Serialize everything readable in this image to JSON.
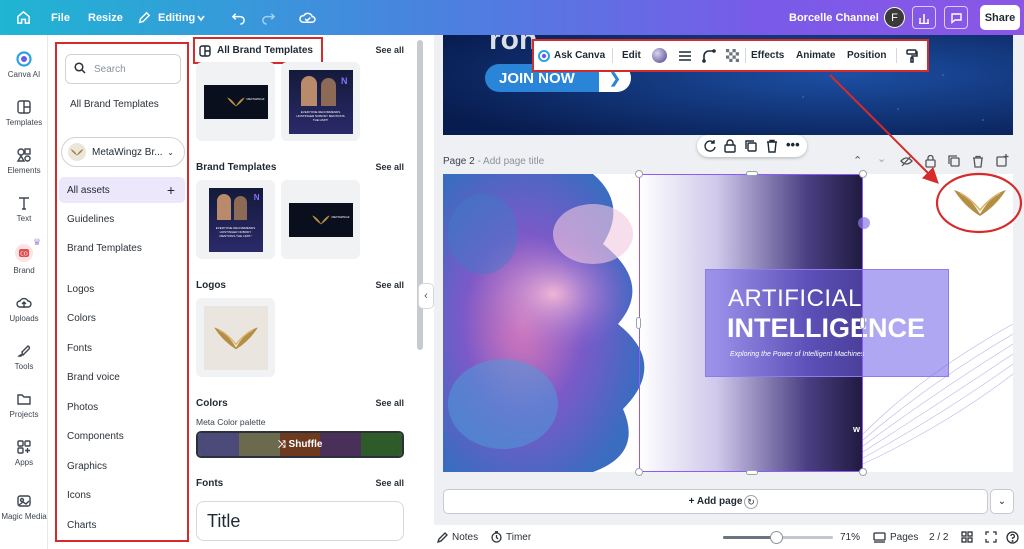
{
  "topbar": {
    "file": "File",
    "resize": "Resize",
    "editing": "Editing",
    "channel": "Borcelle Channel",
    "avatar_initial": "F",
    "share": "Share"
  },
  "rail": {
    "items": [
      {
        "label": "Canva AI",
        "icon": "canva-ai-icon"
      },
      {
        "label": "Templates",
        "icon": "templates-icon"
      },
      {
        "label": "Elements",
        "icon": "elements-icon"
      },
      {
        "label": "Text",
        "icon": "text-icon"
      },
      {
        "label": "Brand",
        "icon": "brand-icon"
      },
      {
        "label": "Uploads",
        "icon": "uploads-icon"
      },
      {
        "label": "Tools",
        "icon": "tools-icon"
      },
      {
        "label": "Projects",
        "icon": "projects-icon"
      },
      {
        "label": "Apps",
        "icon": "apps-icon"
      },
      {
        "label": "Magic Media",
        "icon": "magic-media-icon"
      }
    ]
  },
  "brand_panel": {
    "search_placeholder": "Search",
    "all_brand_templates": "All Brand Templates",
    "brand_kit": "MetaWingz Br...",
    "all_assets": "All assets",
    "items": [
      "Guidelines",
      "Brand Templates",
      "Logos",
      "Colors",
      "Fonts",
      "Brand voice",
      "Photos",
      "Components",
      "Graphics",
      "Icons",
      "Charts"
    ]
  },
  "templates_panel": {
    "header": "All Brand Templates",
    "see_all": "See all",
    "brand_templates": "Brand Templates",
    "logos": "Logos",
    "colors": "Colors",
    "palette_name": "Meta Color palette",
    "shuffle": "Shuffle",
    "fonts": "Fonts",
    "title_font": "Title",
    "palette_colors": [
      "#4b4a79",
      "#6b6a4e",
      "#6d3a1f",
      "#4a2f58",
      "#2f5a2a"
    ],
    "thumb_brand_name": "METAWINGZ",
    "thumb_caption": "EVERYONE RECOMMENDS HOSTINGER NOBODY MENTIONS THE LIMIT!"
  },
  "context_toolbar": {
    "ask_canva": "Ask Canva",
    "edit": "Edit",
    "effects": "Effects",
    "animate": "Animate",
    "position": "Position"
  },
  "canvas": {
    "join_now": "JOIN NOW",
    "page_label": "Page 2",
    "page_title_placeholder": "- Add page title",
    "ai_line1": "ARTIFICIAL",
    "ai_line2": "INTELLIGENCE",
    "ai_line3": "Exploring the Power of Intelligent Machines",
    "watermark": "w",
    "add_page": "+ Add page"
  },
  "bottombar": {
    "notes": "Notes",
    "timer": "Timer",
    "zoom": "71%",
    "zoom_fraction": 0.48,
    "pages": "Pages",
    "page_count": "2 / 2"
  }
}
